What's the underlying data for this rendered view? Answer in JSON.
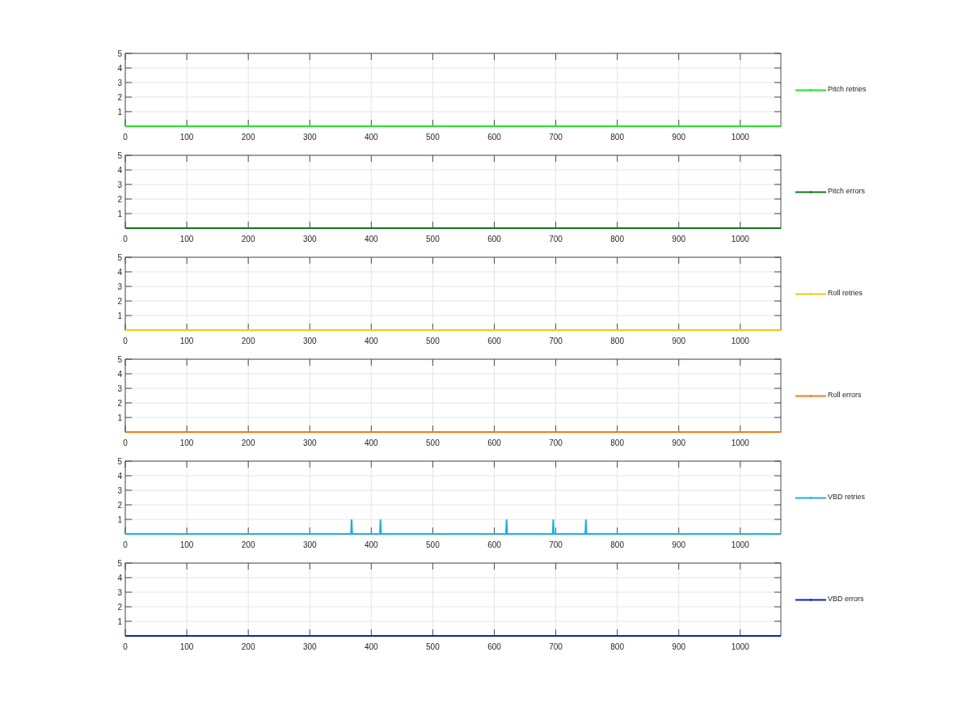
{
  "panels": [
    {
      "chart_data": {
        "type": "line",
        "grid": true,
        "x": [
          0,
          1066
        ],
        "xlim": [
          0,
          1066
        ],
        "ylim": [
          0,
          5
        ],
        "xticks": [
          0,
          100,
          200,
          300,
          400,
          500,
          600,
          700,
          800,
          900,
          1000
        ],
        "yticks": [
          1,
          2,
          3,
          4,
          5
        ],
        "series": [
          {
            "name": "Pitch retries",
            "color": "#22e622",
            "values": [
              0,
              0
            ]
          }
        ]
      }
    },
    {
      "chart_data": {
        "type": "line",
        "grid": true,
        "x": [
          0,
          1066
        ],
        "xlim": [
          0,
          1066
        ],
        "ylim": [
          0,
          5
        ],
        "xticks": [
          0,
          100,
          200,
          300,
          400,
          500,
          600,
          700,
          800,
          900,
          1000
        ],
        "yticks": [
          1,
          2,
          3,
          4,
          5
        ],
        "series": [
          {
            "name": "Pitch errors",
            "color": "#0e7a1a",
            "values": [
              0,
              0
            ]
          }
        ]
      }
    },
    {
      "chart_data": {
        "type": "line",
        "grid": true,
        "x": [
          0,
          1066
        ],
        "xlim": [
          0,
          1066
        ],
        "ylim": [
          0,
          5
        ],
        "xticks": [
          0,
          100,
          200,
          300,
          400,
          500,
          600,
          700,
          800,
          900,
          1000
        ],
        "yticks": [
          1,
          2,
          3,
          4,
          5
        ],
        "series": [
          {
            "name": "Roll retries",
            "color": "#f2cc0c",
            "values": [
              0,
              0
            ]
          }
        ]
      }
    },
    {
      "chart_data": {
        "type": "line",
        "grid": true,
        "x": [
          0,
          1066
        ],
        "xlim": [
          0,
          1066
        ],
        "ylim": [
          0,
          5
        ],
        "xticks": [
          0,
          100,
          200,
          300,
          400,
          500,
          600,
          700,
          800,
          900,
          1000
        ],
        "yticks": [
          1,
          2,
          3,
          4,
          5
        ],
        "series": [
          {
            "name": "Roll errors",
            "color": "#ee7d16",
            "values": [
              0,
              0
            ]
          }
        ]
      }
    },
    {
      "chart_data": {
        "type": "line",
        "grid": true,
        "x": [
          0,
          367,
          368,
          369,
          414,
          415,
          416,
          619,
          620,
          621,
          695,
          696,
          697,
          748,
          749,
          750,
          1066
        ],
        "xlim": [
          0,
          1066
        ],
        "ylim": [
          0,
          5
        ],
        "xticks": [
          0,
          100,
          200,
          300,
          400,
          500,
          600,
          700,
          800,
          900,
          1000
        ],
        "yticks": [
          1,
          2,
          3,
          4,
          5
        ],
        "series": [
          {
            "name": "VBD retries",
            "color": "#1fb0dc",
            "values": [
              0,
              0,
              1,
              0,
              0,
              1,
              0,
              0,
              1,
              0,
              0,
              1,
              0,
              0,
              1,
              0,
              0
            ]
          }
        ]
      }
    },
    {
      "chart_data": {
        "type": "line",
        "grid": true,
        "x": [
          0,
          1066
        ],
        "xlim": [
          0,
          1066
        ],
        "ylim": [
          0,
          5
        ],
        "xticks": [
          0,
          100,
          200,
          300,
          400,
          500,
          600,
          700,
          800,
          900,
          1000
        ],
        "yticks": [
          1,
          2,
          3,
          4,
          5
        ],
        "series": [
          {
            "name": "VBD errors",
            "color": "#1020b8",
            "values": [
              0,
              0
            ]
          }
        ]
      }
    }
  ]
}
